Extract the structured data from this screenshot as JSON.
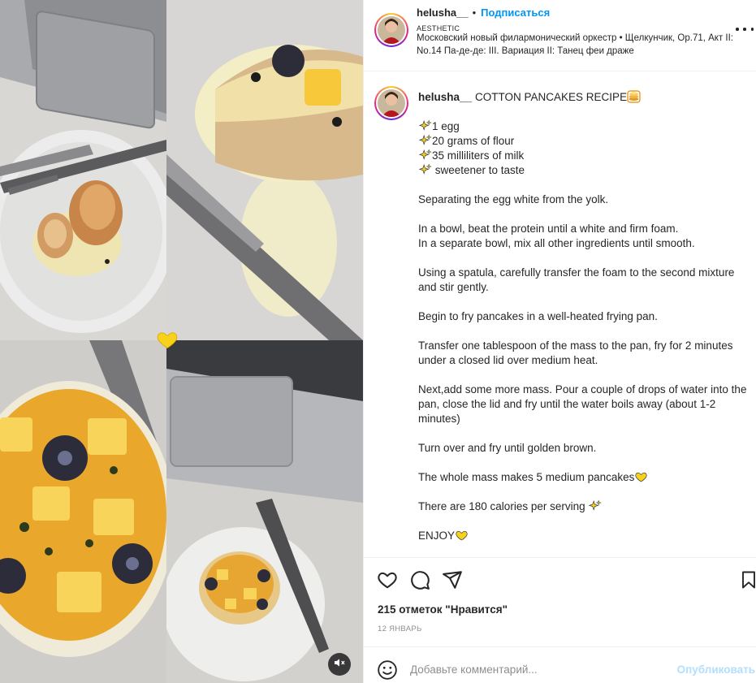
{
  "post": {
    "username": "helusha__",
    "follow_label": "Подписаться",
    "separator": "•",
    "audio_title": "AESTHETIC",
    "audio_track": "Московский новый филармонический оркестр • Щелкунчик, Ор.71, Акт II: No.14 Па-де-де: III. Вариация II: Танец феи драже"
  },
  "caption": {
    "title": "COTTON PANCAKES RECIPE",
    "ingredients": [
      "1 egg",
      "20 grams of flour",
      "35 milliliters of milk",
      " sweetener to taste"
    ],
    "steps": [
      "Separating the egg white from the yolk.",
      "In a bowl, beat the protein until a white and firm foam.\nIn a separate bowl, mix all other ingredients until smooth.",
      "Using a spatula, carefully transfer the foam to the second mixture and stir gently.",
      "Begin to fry pancakes in a well-heated frying pan.",
      "Transfer one tablespoon of the mass to the pan, fry for 2 minutes under a closed lid over medium heat.",
      "Next,add some more mass. Pour a couple of drops of water into the pan, close the lid and fry until the water boils away (about 1-2 minutes)",
      "Turn over and fry until golden brown."
    ],
    "yield_text": "The whole mass makes 5 medium pancakes",
    "calories_text": "There are 180 calories per serving",
    "enjoy_text": "ENJOY"
  },
  "engagement": {
    "likes": "215 отметок \"Нравится\"",
    "date": "12 ЯНВАРЬ"
  },
  "comment": {
    "placeholder": "Добавьте комментарий...",
    "publish_label": "Опубликовать"
  },
  "icons": {
    "heart": "heart-icon",
    "comment": "comment-icon",
    "share": "paper-plane-icon",
    "save": "bookmark-icon",
    "emoji": "smiley-icon",
    "sparkle": "sparkles-icon",
    "pancake": "pancakes-emoji-icon",
    "yellow_heart": "yellow-heart-icon",
    "mute": "speaker-muted-icon",
    "more": "more-options-icon"
  },
  "colors": {
    "link_blue": "#0095f6",
    "publish_disabled": "#b2dffc",
    "muted_text": "#8e8e8e",
    "yellow_heart": "#f7d21b"
  }
}
